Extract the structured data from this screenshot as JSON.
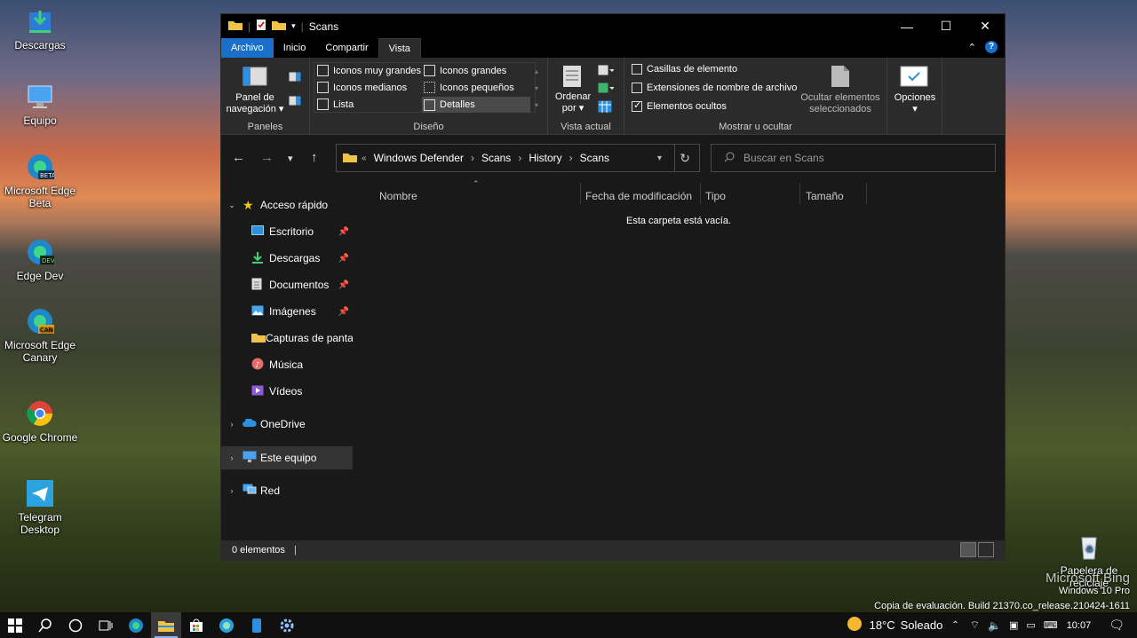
{
  "desktop": {
    "icons": [
      {
        "label": "Descargas",
        "icon": "download-folder-icon"
      },
      {
        "label": "Equipo",
        "icon": "computer-icon"
      },
      {
        "label": "Microsoft Edge Beta",
        "icon": "edge-beta-icon"
      },
      {
        "label": "Edge Dev",
        "icon": "edge-dev-icon"
      },
      {
        "label": "Microsoft Edge Canary",
        "icon": "edge-canary-icon"
      },
      {
        "label": "Google Chrome",
        "icon": "chrome-icon"
      },
      {
        "label": "Telegram Desktop",
        "icon": "telegram-icon"
      }
    ],
    "recycle_bin": "Papelera de reciclaje",
    "watermark": {
      "brand": "Microsoft Bing",
      "os": "Windows 10 Pro",
      "build": "Copia de evaluación. Build 21370.co_release.210424-1611"
    }
  },
  "window": {
    "title": "Scans",
    "tabs": [
      "Archivo",
      "Inicio",
      "Compartir",
      "Vista"
    ],
    "active_tab": "Vista",
    "ribbon": {
      "panes": {
        "nav_pane": "Panel de navegación",
        "label": "Paneles"
      },
      "layout": {
        "items": [
          "Iconos muy grandes",
          "Iconos grandes",
          "Iconos medianos",
          "Iconos pequeños",
          "Lista",
          "Detalles"
        ],
        "selected": "Detalles",
        "label": "Diseño"
      },
      "current_view": {
        "sort_by": "Ordenar por",
        "label": "Vista actual"
      },
      "show_hide": {
        "checkboxes": [
          {
            "label": "Casillas de elemento",
            "checked": false
          },
          {
            "label": "Extensiones de nombre de archivo",
            "checked": false
          },
          {
            "label": "Elementos ocultos",
            "checked": true
          }
        ],
        "hide_selected": "Ocultar elementos seleccionados",
        "label": "Mostrar u ocultar"
      },
      "options": "Opciones"
    },
    "address": {
      "overflow": "«",
      "crumbs": [
        "Windows Defender",
        "Scans",
        "History",
        "Scans"
      ]
    },
    "search_placeholder": "Buscar en Scans",
    "sidebar": {
      "quick_access": "Acceso rápido",
      "items": [
        {
          "label": "Escritorio",
          "pinned": true
        },
        {
          "label": "Descargas",
          "pinned": true
        },
        {
          "label": "Documentos",
          "pinned": true
        },
        {
          "label": "Imágenes",
          "pinned": true
        },
        {
          "label": "Capturas de pantal",
          "pinned": false
        },
        {
          "label": "Música",
          "pinned": false
        },
        {
          "label": "Vídeos",
          "pinned": false
        }
      ],
      "onedrive": "OneDrive",
      "this_pc": "Este equipo",
      "network": "Red"
    },
    "columns": [
      "Nombre",
      "Fecha de modificación",
      "Tipo",
      "Tamaño"
    ],
    "empty_message": "Esta carpeta está vacía.",
    "status": "0 elementos"
  },
  "taskbar": {
    "weather": "18°C",
    "weather_desc": "Soleado",
    "time": "10:07"
  },
  "colors": {
    "accent": "#1a6fc9",
    "window_bg": "#191919",
    "ribbon_bg": "#2b2b2b"
  }
}
